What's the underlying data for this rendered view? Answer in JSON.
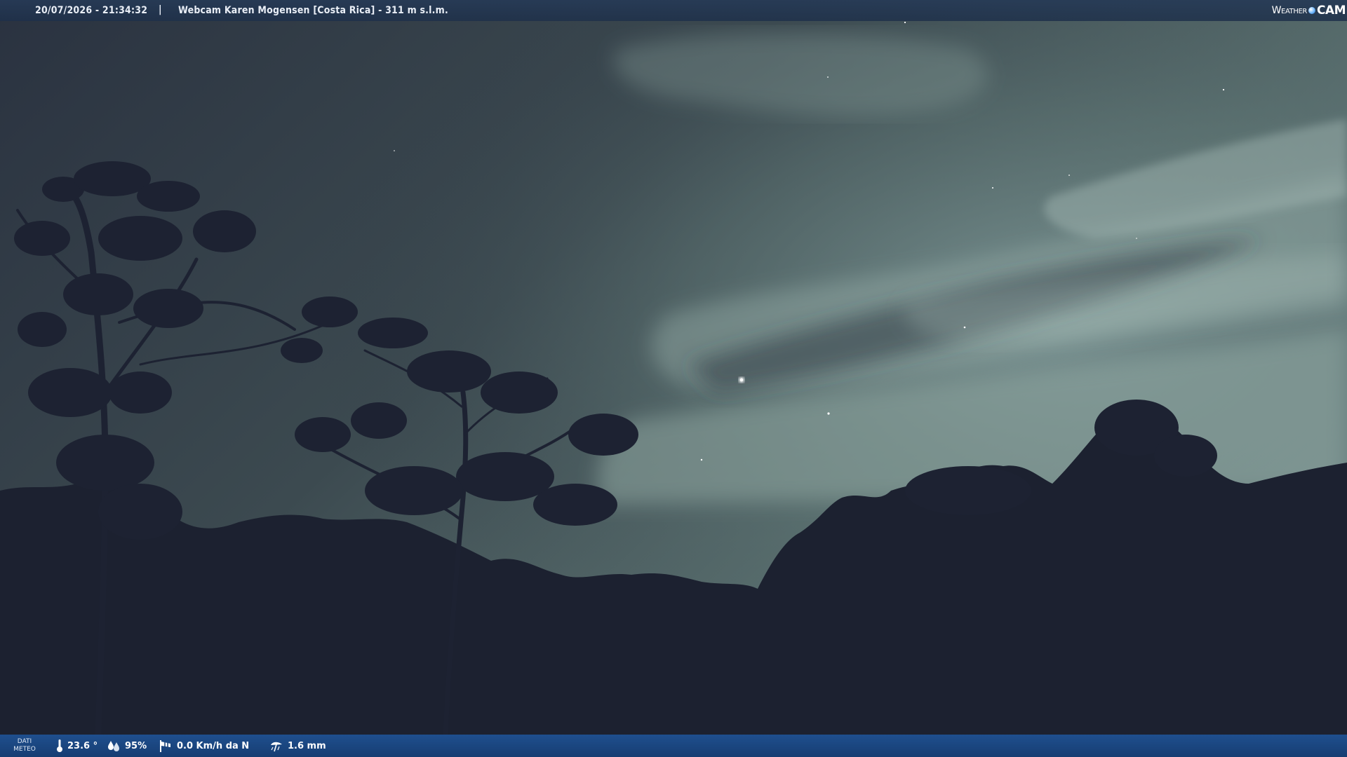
{
  "header": {
    "timestamp": "20/07/2026 - 21:34:32",
    "separator": "|",
    "title": "Webcam Karen Mogensen [Costa Rica] - 311 m s.l.m.",
    "logo_weather": "Weather",
    "logo_cam": "CAM"
  },
  "weather_bar": {
    "label_line1": "DATI",
    "label_line2": "METEO",
    "temperature": "23.6 °",
    "humidity": "95%",
    "wind": "0.0 Km/h da N",
    "rain": "1.6 mm"
  },
  "icons": {
    "temperature": "thermometer-icon",
    "humidity": "humidity-drop-icon",
    "wind": "wind-sock-icon",
    "rain": "rain-gauge-icon"
  },
  "colors": {
    "top_bar": "#263a56",
    "bottom_bar": "#1f4f8e",
    "sky_dark": "#2a3341",
    "sky_light": "#6f8785",
    "foliage": "#1a1e2b"
  }
}
